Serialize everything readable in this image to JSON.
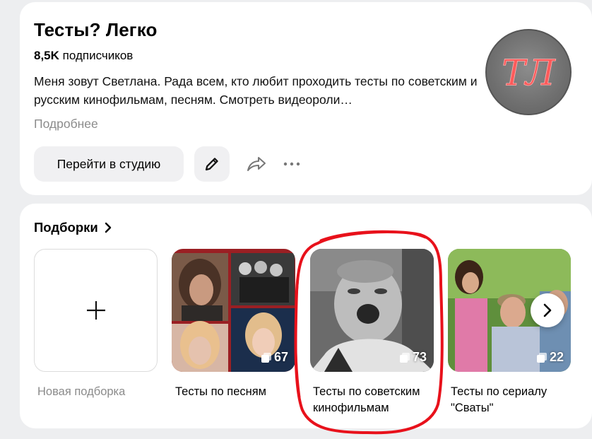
{
  "channel": {
    "title": "Тесты? Легко",
    "subscribers_count": "8,5K",
    "subscribers_label": "подписчиков",
    "description": "Меня зовут Светлана. Рада всем, кто любит проходить тесты по советским и русским кинофильмам, песням. Смотреть видеороли…",
    "more_link": "Подробнее",
    "avatar_text": "ТЛ",
    "studio_button": "Перейти в студию",
    "accent_color": "#ff4b4b"
  },
  "collections": {
    "title": "Подборки",
    "new_label": "Новая подборка",
    "items": [
      {
        "label": "Тесты по песням",
        "count": "67"
      },
      {
        "label": "Тесты по советским кинофильмам",
        "count": "73"
      },
      {
        "label": "Тесты по сериалу \"Сваты\"",
        "count": "22"
      }
    ]
  },
  "annotation_color": "#e8111b"
}
